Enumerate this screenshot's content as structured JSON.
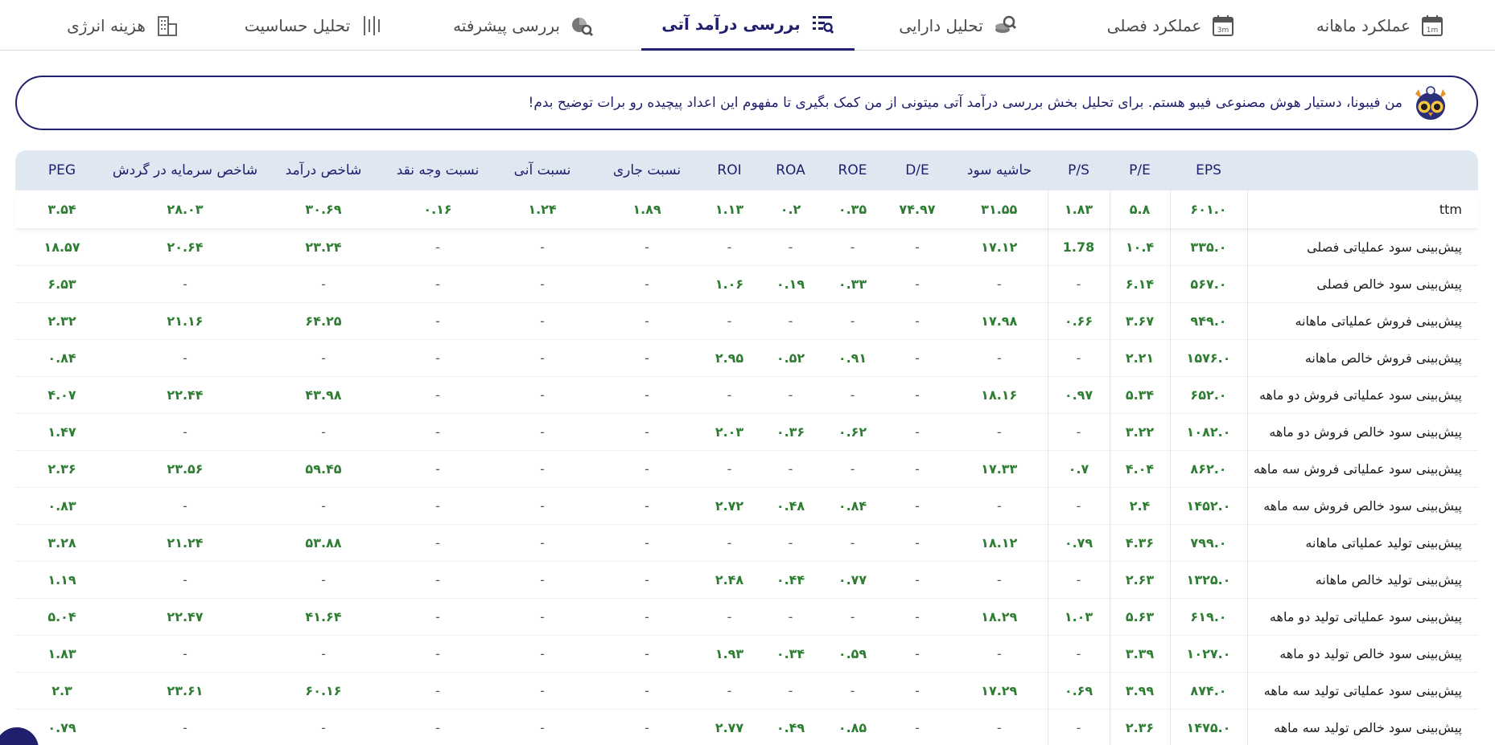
{
  "tabs": [
    {
      "label": "عملکرد ماهانه",
      "icon": "calendar-1m-icon",
      "active": false
    },
    {
      "label": "عملکرد فصلی",
      "icon": "calendar-3m-icon",
      "active": false
    },
    {
      "label": "تحلیل دارایی",
      "icon": "asset-analysis-icon",
      "active": false
    },
    {
      "label": "بررسی درآمد آتی",
      "icon": "future-income-icon",
      "active": true
    },
    {
      "label": "بررسی پیشرفته",
      "icon": "advanced-review-icon",
      "active": false
    },
    {
      "label": "تحلیل حساسیت",
      "icon": "sensitivity-icon",
      "active": false
    },
    {
      "label": "هزینه انرژی",
      "icon": "energy-building-icon",
      "active": false
    }
  ],
  "banner": {
    "text": "من فیبونا، دستیار هوش مصنوعی فیبو هستم. برای تحلیل بخش بررسی درآمد آتی میتونی از من کمک بگیری تا مفهوم این اعداد پیچیده رو برات توضیح بدم!",
    "icon": "owl-assistant-icon"
  },
  "table": {
    "headers": [
      "",
      "EPS",
      "P/E",
      "P/S",
      "حاشیه سود",
      "D/E",
      "ROE",
      "ROA",
      "ROI",
      "نسبت جاری",
      "نسبت آنی",
      "نسبت وجه نقد",
      "شاخص درآمد",
      "شاخص سرمایه در گردش",
      "PEG"
    ],
    "ttm": [
      "ttm",
      "۶۰۱.۰",
      "۵.۸",
      "۱.۸۳",
      "۳۱.۵۵",
      "۷۴.۹۷",
      "۰.۳۵",
      "۰.۲",
      "۱.۱۳",
      "۱.۸۹",
      "۱.۲۴",
      "۰.۱۶",
      "۳۰.۶۹",
      "۲۸.۰۳",
      "۳.۵۴"
    ],
    "rows": [
      [
        "پیش‌بینی سود عملیاتی فصلی",
        "۳۳۵.۰",
        "۱۰.۴",
        "1.78",
        "۱۷.۱۲",
        "-",
        "-",
        "-",
        "-",
        "-",
        "-",
        "-",
        "۲۳.۲۴",
        "۲۰.۶۴",
        "۱۸.۵۷"
      ],
      [
        "پیش‌بینی سود خالص فصلی",
        "۵۶۷.۰",
        "۶.۱۴",
        "-",
        "-",
        "-",
        "۰.۳۳",
        "۰.۱۹",
        "۱.۰۶",
        "-",
        "-",
        "-",
        "-",
        "-",
        "۶.۵۳"
      ],
      [
        "پیش‌بینی فروش عملیاتی ماهانه",
        "۹۴۹.۰",
        "۳.۶۷",
        "۰.۶۶",
        "۱۷.۹۸",
        "-",
        "-",
        "-",
        "-",
        "-",
        "-",
        "-",
        "۶۴.۲۵",
        "۲۱.۱۶",
        "۲.۳۲"
      ],
      [
        "پیش‌بینی فروش خالص ماهانه",
        "۱۵۷۶.۰",
        "۲.۲۱",
        "-",
        "-",
        "-",
        "۰.۹۱",
        "۰.۵۲",
        "۲.۹۵",
        "-",
        "-",
        "-",
        "-",
        "-",
        "۰.۸۴"
      ],
      [
        "پیش‌بینی سود عملیاتی فروش دو ماهه",
        "۶۵۲.۰",
        "۵.۳۴",
        "۰.۹۷",
        "۱۸.۱۶",
        "-",
        "-",
        "-",
        "-",
        "-",
        "-",
        "-",
        "۴۳.۹۸",
        "۲۲.۴۴",
        "۴.۰۷"
      ],
      [
        "پیش‌بینی سود خالص فروش دو ماهه",
        "۱۰۸۲.۰",
        "۳.۲۲",
        "-",
        "-",
        "-",
        "۰.۶۲",
        "۰.۳۶",
        "۲.۰۳",
        "-",
        "-",
        "-",
        "-",
        "-",
        "۱.۴۷"
      ],
      [
        "پیش‌بینی سود عملیاتی فروش سه ماهه",
        "۸۶۲.۰",
        "۴.۰۴",
        "۰.۷",
        "۱۷.۳۳",
        "-",
        "-",
        "-",
        "-",
        "-",
        "-",
        "-",
        "۵۹.۴۵",
        "۲۳.۵۶",
        "۲.۳۶"
      ],
      [
        "پیش‌بینی سود خالص فروش سه ماهه",
        "۱۴۵۲.۰",
        "۲.۴",
        "-",
        "-",
        "-",
        "۰.۸۴",
        "۰.۴۸",
        "۲.۷۲",
        "-",
        "-",
        "-",
        "-",
        "-",
        "۰.۸۳"
      ],
      [
        "پیش‌بینی تولید عملیاتی ماهانه",
        "۷۹۹.۰",
        "۴.۳۶",
        "۰.۷۹",
        "۱۸.۱۲",
        "-",
        "-",
        "-",
        "-",
        "-",
        "-",
        "-",
        "۵۳.۸۸",
        "۲۱.۲۴",
        "۳.۲۸"
      ],
      [
        "پیش‌بینی تولید خالص ماهانه",
        "۱۳۲۵.۰",
        "۲.۶۳",
        "-",
        "-",
        "-",
        "۰.۷۷",
        "۰.۴۴",
        "۲.۴۸",
        "-",
        "-",
        "-",
        "-",
        "-",
        "۱.۱۹"
      ],
      [
        "پیش‌بینی سود عملیاتی تولید دو ماهه",
        "۶۱۹.۰",
        "۵.۶۳",
        "۱.۰۳",
        "۱۸.۲۹",
        "-",
        "-",
        "-",
        "-",
        "-",
        "-",
        "-",
        "۴۱.۶۴",
        "۲۲.۴۷",
        "۵.۰۴"
      ],
      [
        "پیش‌بینی سود خالص تولید دو ماهه",
        "۱۰۲۷.۰",
        "۳.۳۹",
        "-",
        "-",
        "-",
        "۰.۵۹",
        "۰.۳۴",
        "۱.۹۳",
        "-",
        "-",
        "-",
        "-",
        "-",
        "۱.۸۳"
      ],
      [
        "پیش‌بینی سود عملیاتی تولید سه ماهه",
        "۸۷۴.۰",
        "۳.۹۹",
        "۰.۶۹",
        "۱۷.۲۹",
        "-",
        "-",
        "-",
        "-",
        "-",
        "-",
        "-",
        "۶۰.۱۶",
        "۲۳.۶۱",
        "۲.۳"
      ],
      [
        "پیش‌بینی سود خالص تولید سه ماهه",
        "۱۴۷۵.۰",
        "۲.۳۶",
        "-",
        "-",
        "-",
        "۰.۸۵",
        "۰.۴۹",
        "۲.۷۷",
        "-",
        "-",
        "-",
        "-",
        "-",
        "۰.۷۹"
      ]
    ]
  },
  "colors": {
    "primary": "#1f1f6e",
    "positive": "#2e7d32",
    "header_bg": "#dfe8f1"
  }
}
